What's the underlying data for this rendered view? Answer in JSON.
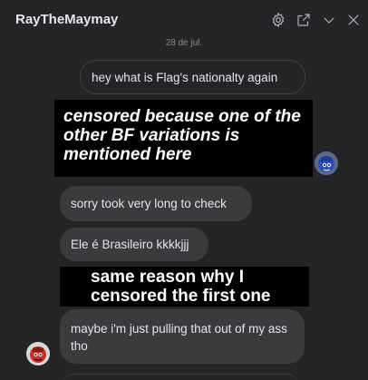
{
  "header": {
    "title": "RayTheMaymay",
    "icons": [
      "gear-icon",
      "popout-icon",
      "chevron-down-icon",
      "close-icon"
    ]
  },
  "thread": {
    "date": "28 de jul.",
    "messages": [
      {
        "from": "me",
        "text": "hey what is Flag's nationalty again"
      },
      {
        "from": "overlay",
        "text": "censored because one of the other BF variations is mentioned here"
      },
      {
        "from": "them",
        "text": "sorry took very long to check"
      },
      {
        "from": "them",
        "text": "Ele é Brasileiro kkkkjjj"
      },
      {
        "from": "overlay",
        "text": "same reason why I censored the first one"
      },
      {
        "from": "them",
        "text": "maybe i'm just pulling that out of my ass tho"
      }
    ]
  },
  "colors": {
    "background": "#242526",
    "incoming_bubble": "#3a3b3c",
    "outgoing_border": "#3e4042",
    "text": "#e4e6eb",
    "muted": "#8a8d91"
  }
}
